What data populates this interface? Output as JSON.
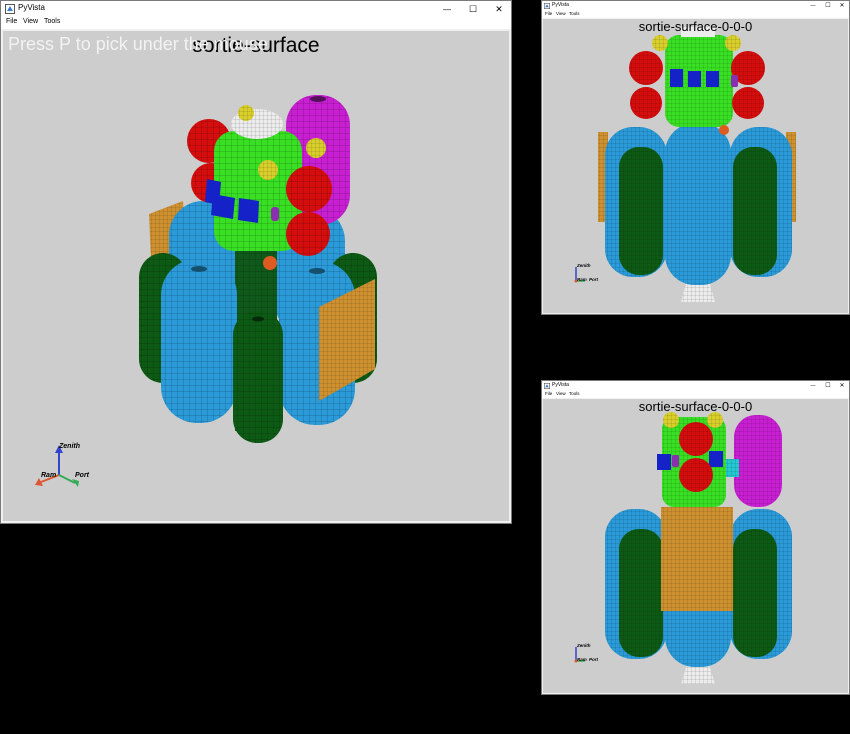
{
  "windows": {
    "main": {
      "title": "PyVista",
      "menu": [
        "File",
        "View",
        "Tools"
      ],
      "view_title": "sortie-surface",
      "overlay": "Press P to pick under the mouse"
    },
    "top_right": {
      "title": "PyVista",
      "menu": [
        "File",
        "View",
        "Tools"
      ],
      "view_title": "sortie-surface-0-0-0"
    },
    "bottom_right": {
      "title": "PyVista",
      "menu": [
        "File",
        "View",
        "Tools"
      ],
      "view_title": "sortie-surface-0-0-0"
    }
  },
  "axes": {
    "zenith": "Zenith",
    "ram": "Ram",
    "port": "Port"
  },
  "controls": {
    "minimize": "—",
    "maximize": "☐",
    "close": "✕"
  },
  "colors": {
    "background": "#cdcdcd",
    "tank_blue": "#2a9ad8",
    "tank_dark_green": "#0d5a14",
    "module_green": "#38df23",
    "sphere_red": "#d50d0d",
    "sphere_yellow": "#d8cf2b",
    "tank_magenta": "#c81fd2",
    "panel_orange": "#cf902f",
    "panel_blue": "#1522c8",
    "axis_zenith": "#3344cc",
    "axis_ram": "#dd5533",
    "axis_port": "#33aa55"
  }
}
